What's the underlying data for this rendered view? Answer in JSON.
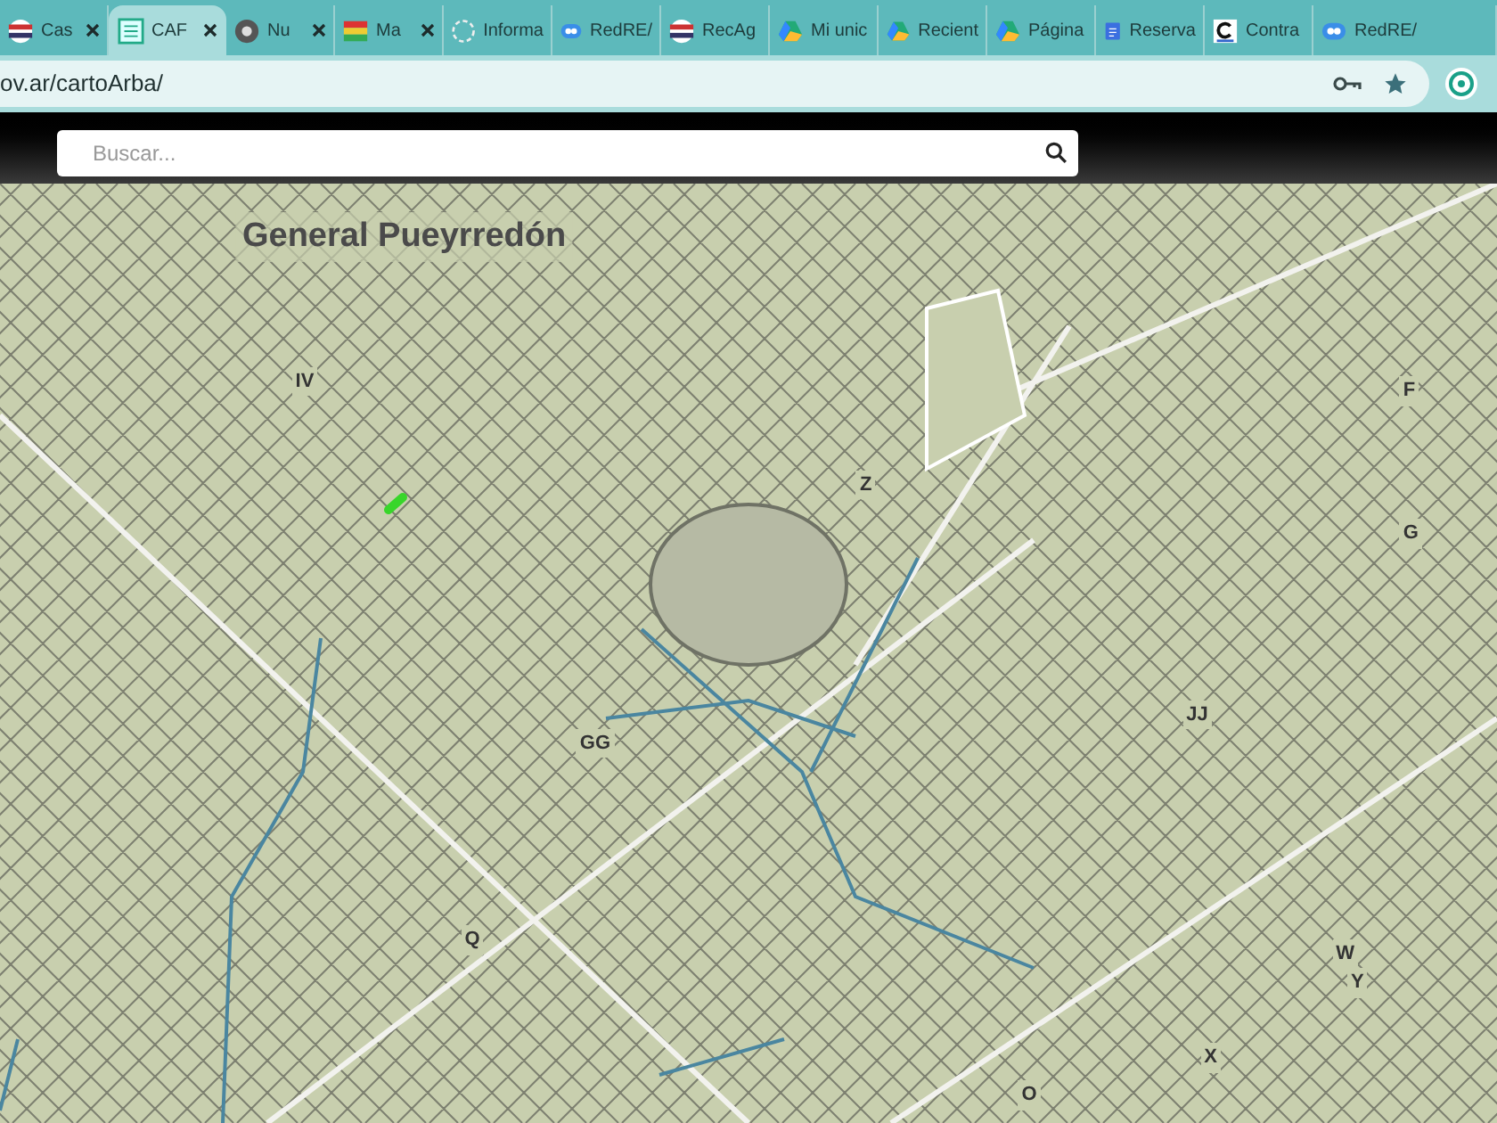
{
  "tabs": [
    {
      "title": "Cas",
      "selected": false
    },
    {
      "title": "CAF",
      "selected": true
    },
    {
      "title": "Nu",
      "selected": false
    },
    {
      "title": "Ma",
      "selected": false
    },
    {
      "title": "Informa",
      "selected": false
    },
    {
      "title": "RedRE/",
      "selected": false
    },
    {
      "title": "RecAg",
      "selected": false
    },
    {
      "title": "Mi unic",
      "selected": false
    },
    {
      "title": "Recient",
      "selected": false
    },
    {
      "title": "Página",
      "selected": false
    },
    {
      "title": "Reserva",
      "selected": false
    },
    {
      "title": "Contra",
      "selected": false
    },
    {
      "title": "RedRE/",
      "selected": false
    }
  ],
  "address_bar": {
    "domain": "ov.ar",
    "path": "/cartoArba/"
  },
  "search": {
    "placeholder": "Buscar..."
  },
  "map": {
    "labels": [
      {
        "text": "General Pueyrredón",
        "kind": "title"
      },
      {
        "text": "IV",
        "kind": "zone"
      },
      {
        "text": "Z",
        "kind": "zone"
      },
      {
        "text": "F",
        "kind": "zone"
      },
      {
        "text": "G",
        "kind": "zone"
      },
      {
        "text": "GG",
        "kind": "zone"
      },
      {
        "text": "JJ",
        "kind": "zone"
      },
      {
        "text": "Q",
        "kind": "zone"
      },
      {
        "text": "W",
        "kind": "zone"
      },
      {
        "text": "Y",
        "kind": "zone"
      },
      {
        "text": "X",
        "kind": "zone"
      },
      {
        "text": "O",
        "kind": "zone"
      }
    ]
  }
}
